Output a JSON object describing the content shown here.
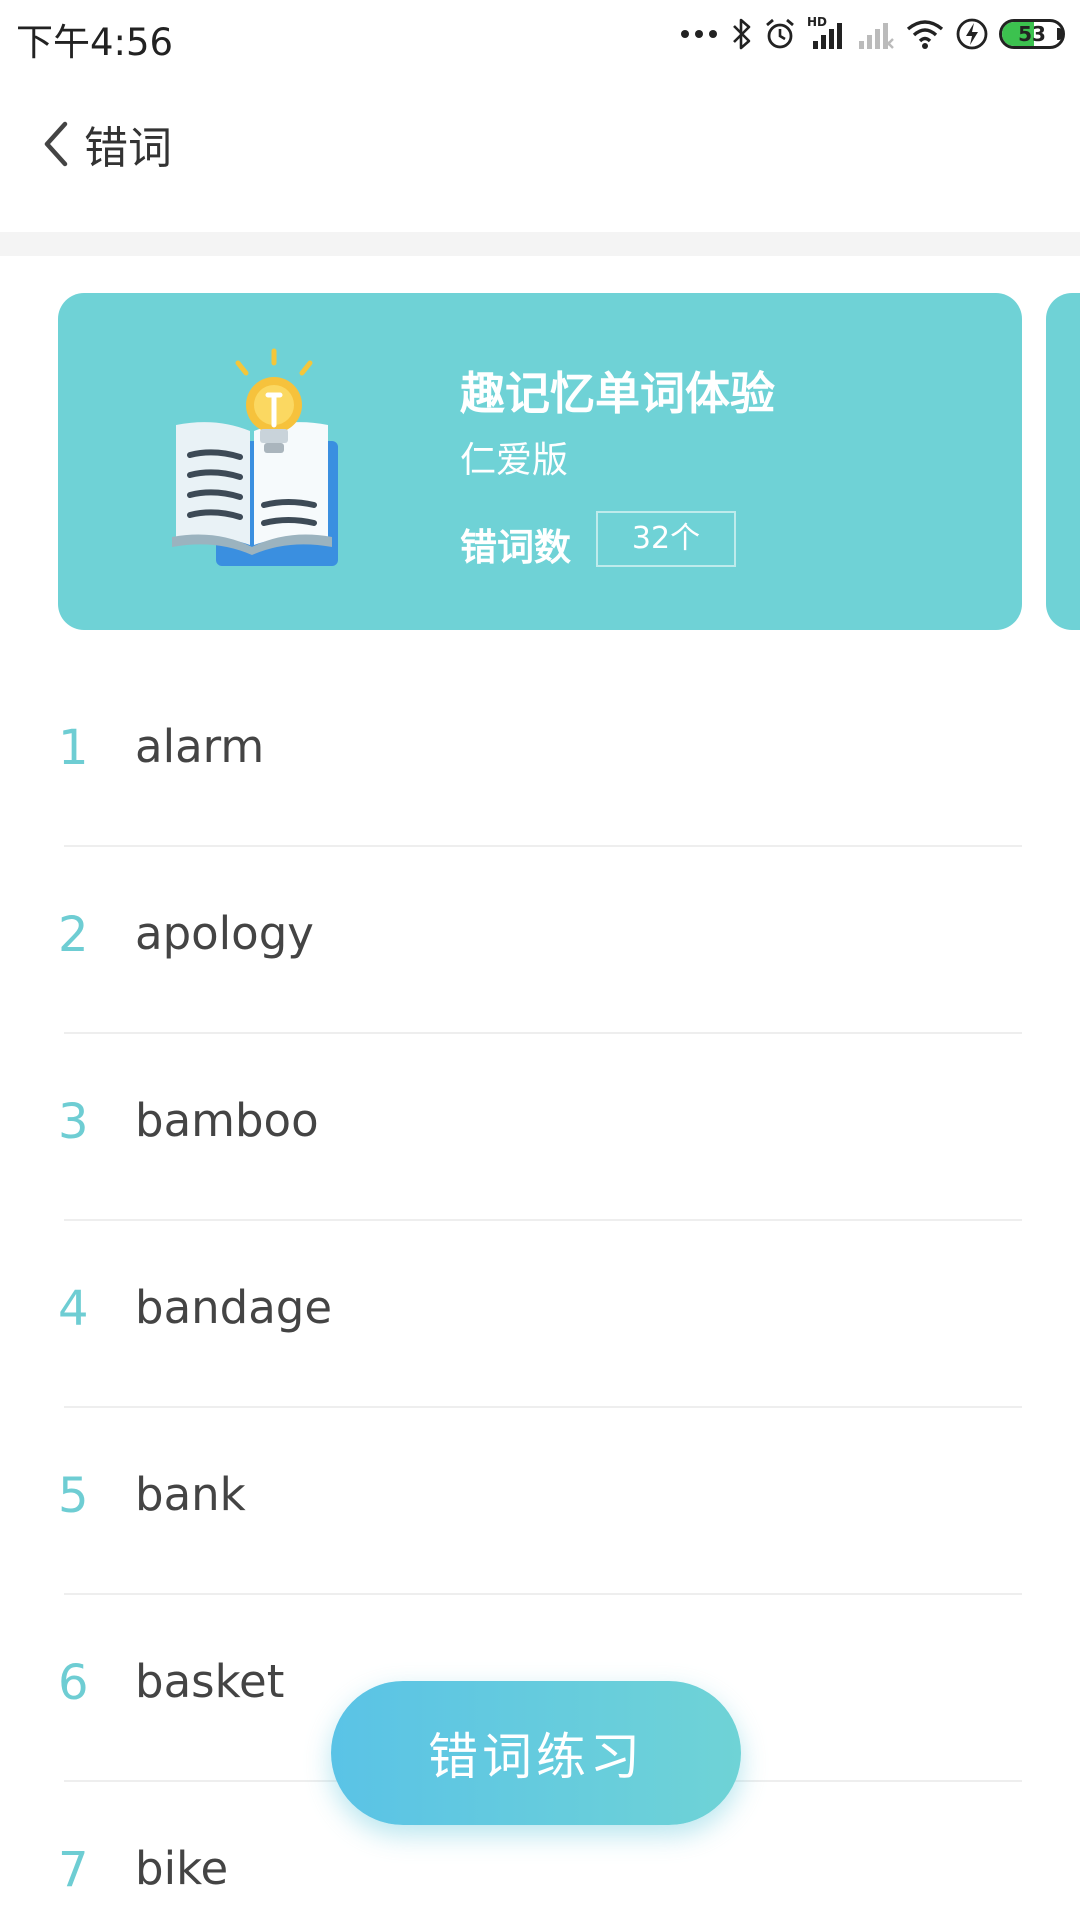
{
  "status_bar": {
    "time": "下午4:56",
    "battery_level": "53",
    "battery_fraction": 0.53,
    "battery_color": "#3cc24f",
    "network_label": "HD"
  },
  "header": {
    "back_icon": "chevron-left-icon",
    "title": "错词"
  },
  "card": {
    "background": "#6fd2d6",
    "illustration": "book-lightbulb-icon",
    "title": "趣记忆单词体验",
    "subtitle": "仁爱版",
    "count_label": "错词数",
    "count_value": "32个"
  },
  "words": [
    {
      "index": "1",
      "word": "alarm"
    },
    {
      "index": "2",
      "word": "apology"
    },
    {
      "index": "3",
      "word": "bamboo"
    },
    {
      "index": "4",
      "word": "bandage"
    },
    {
      "index": "5",
      "word": "bank"
    },
    {
      "index": "6",
      "word": "basket"
    },
    {
      "index": "7",
      "word": "bike"
    }
  ],
  "practice_button": {
    "label": "错词练习"
  },
  "accent_color": "#6ecdd3"
}
